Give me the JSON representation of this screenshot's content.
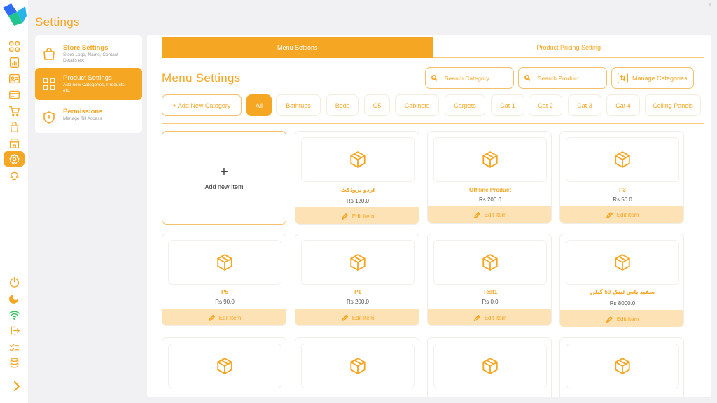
{
  "page_title": "Settings",
  "brand_colors": {
    "accent": "#f5a623",
    "accent_light": "#fde2b5",
    "background": "#f1f1f4"
  },
  "sidebar_icons": [
    "dashboard-grid-icon",
    "reports-icon",
    "contacts-icon",
    "payments-card-icon",
    "cart-icon",
    "bag-icon",
    "store-icon",
    "settings-gear-icon",
    "support-icon",
    "power-icon",
    "dark-mode-icon",
    "wifi-icon",
    "logout-icon",
    "tasks-icon",
    "database-icon",
    "expand-chevron-icon"
  ],
  "settings_menu": [
    {
      "title": "Store Settings",
      "subtitle": "Store Logo, Name, Contact Details etc.",
      "icon": "bag-icon"
    },
    {
      "title": "Product Settings",
      "subtitle": "Add new Categories, Products etc.",
      "icon": "grid-icon"
    },
    {
      "title": "Permissions",
      "subtitle": "Manage Till Access",
      "icon": "shield-icon"
    }
  ],
  "tabs": [
    {
      "label": "Menu Settions"
    },
    {
      "label": "Product Pricing Setting"
    }
  ],
  "section_title": "Menu Settings",
  "search_category": {
    "placeholder": "Search Category..."
  },
  "search_product": {
    "placeholder": "Search Product..."
  },
  "manage_categories": {
    "label": "Manage Categories"
  },
  "categories": {
    "add_label": "+ Add New Category",
    "items": [
      "All",
      "Bathtubs",
      "Beds",
      "C5",
      "Cabinets",
      "Carpets",
      "Cat 1",
      "Cat 2",
      "Cat 3",
      "Cat 4",
      "Ceiling Panels"
    ],
    "selected": "All"
  },
  "add_item": {
    "plus": "+",
    "label": "Add new Item"
  },
  "edit_label": "Edit Item",
  "products": [
    {
      "name": "اردو پروڈکٹ",
      "price": "Rs 120.0"
    },
    {
      "name": "Offiline Product",
      "price": "Rs 200.0"
    },
    {
      "name": "P3",
      "price": "Rs 50.0"
    },
    {
      "name": "P5",
      "price": "Rs 90.0"
    },
    {
      "name": "P1",
      "price": "Rs 200.0"
    },
    {
      "name": "Test1",
      "price": "Rs 0.0"
    },
    {
      "name": "سفید پانی ٹینک 50 گیلن",
      "price": "Rs 8000.0"
    }
  ]
}
